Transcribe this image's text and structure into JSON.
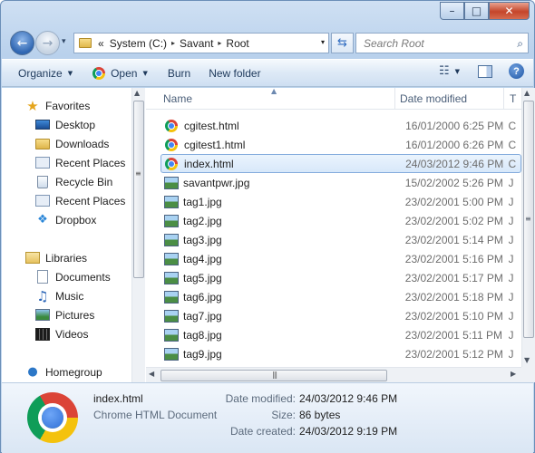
{
  "window": {
    "caption_buttons": {
      "minimize": "–",
      "maximize": "□",
      "close": "✕"
    }
  },
  "address_bar": {
    "overflow": "«",
    "segments": [
      "System (C:)",
      "Savant",
      "Root"
    ],
    "separator": "▸",
    "dropdown": "▾",
    "refresh": "⇆"
  },
  "search": {
    "placeholder": "Search Root",
    "icon": "⌕"
  },
  "toolbar": {
    "organize": "Organize",
    "open": "Open",
    "burn": "Burn",
    "new_folder": "New folder",
    "arrow": "▼"
  },
  "nav": {
    "favorites": "Favorites",
    "desktop": "Desktop",
    "downloads": "Downloads",
    "recent_places_1": "Recent Places",
    "recycle_bin": "Recycle Bin",
    "recent_places_2": "Recent Places",
    "dropbox": "Dropbox",
    "libraries": "Libraries",
    "documents": "Documents",
    "music": "Music",
    "pictures": "Pictures",
    "videos": "Videos",
    "homegroup": "Homegroup"
  },
  "columns": {
    "name": "Name",
    "date": "Date modified",
    "type": "T"
  },
  "files": [
    {
      "name": "cgitest.html",
      "date": "16/01/2000 6:25 PM",
      "type": "C",
      "kind": "chrome"
    },
    {
      "name": "cgitest1.html",
      "date": "16/01/2000 6:26 PM",
      "type": "C",
      "kind": "chrome"
    },
    {
      "name": "index.html",
      "date": "24/03/2012 9:46 PM",
      "type": "C",
      "kind": "chrome",
      "selected": true
    },
    {
      "name": "savantpwr.jpg",
      "date": "15/02/2002 5:26 PM",
      "type": "J",
      "kind": "image"
    },
    {
      "name": "tag1.jpg",
      "date": "23/02/2001 5:00 PM",
      "type": "J",
      "kind": "image"
    },
    {
      "name": "tag2.jpg",
      "date": "23/02/2001 5:02 PM",
      "type": "J",
      "kind": "image"
    },
    {
      "name": "tag3.jpg",
      "date": "23/02/2001 5:14 PM",
      "type": "J",
      "kind": "image"
    },
    {
      "name": "tag4.jpg",
      "date": "23/02/2001 5:16 PM",
      "type": "J",
      "kind": "image"
    },
    {
      "name": "tag5.jpg",
      "date": "23/02/2001 5:17 PM",
      "type": "J",
      "kind": "image"
    },
    {
      "name": "tag6.jpg",
      "date": "23/02/2001 5:18 PM",
      "type": "J",
      "kind": "image"
    },
    {
      "name": "tag7.jpg",
      "date": "23/02/2001 5:10 PM",
      "type": "J",
      "kind": "image"
    },
    {
      "name": "tag8.jpg",
      "date": "23/02/2001 5:11 PM",
      "type": "J",
      "kind": "image"
    },
    {
      "name": "tag9.jpg",
      "date": "23/02/2001 5:12 PM",
      "type": "J",
      "kind": "image"
    }
  ],
  "details": {
    "name": "index.html",
    "type": "Chrome HTML Document",
    "date_modified_label": "Date modified:",
    "date_modified": "24/03/2012 9:46 PM",
    "size_label": "Size:",
    "size": "86 bytes",
    "date_created_label": "Date created:",
    "date_created": "24/03/2012 9:19 PM"
  },
  "scroll_glyphs": {
    "up": "▲",
    "down": "▼",
    "left": "◀",
    "right": "▶",
    "grip_v": "≡",
    "grip_h": "|||"
  }
}
